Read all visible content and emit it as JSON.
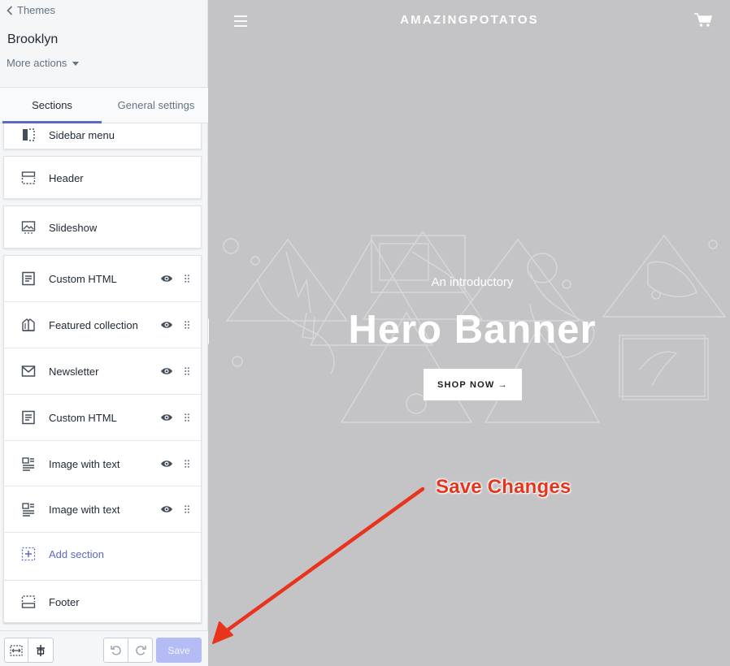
{
  "sidebar": {
    "back_label": "Themes",
    "theme_name": "Brooklyn",
    "more_actions_label": "More actions",
    "tabs": [
      {
        "label": "Sections"
      },
      {
        "label": "General settings"
      }
    ],
    "sections": [
      {
        "label": "Sidebar menu",
        "icon": "sidebar-layout-icon"
      },
      {
        "label": "Header",
        "icon": "header-layout-icon"
      },
      {
        "label": "Slideshow",
        "icon": "slideshow-icon"
      },
      {
        "label": "Custom HTML",
        "icon": "document-text-icon"
      },
      {
        "label": "Featured collection",
        "icon": "collection-book-icon"
      },
      {
        "label": "Newsletter",
        "icon": "mail-icon"
      },
      {
        "label": "Custom HTML",
        "icon": "document-text-icon"
      },
      {
        "label": "Image with text",
        "icon": "image-text-icon"
      },
      {
        "label": "Image with text",
        "icon": "image-text-icon"
      },
      {
        "label": "Add section",
        "icon": "add-section-icon"
      },
      {
        "label": "Footer",
        "icon": "footer-layout-icon"
      }
    ],
    "save_label": "Save"
  },
  "preview": {
    "brand": "AMAZINGPOTATOS",
    "hero_subtitle": "An introductory",
    "hero_title": "Hero Banner",
    "shop_button": "SHOP NOW →"
  },
  "annotation": {
    "text": "Save Changes",
    "color": "#e8341c"
  },
  "colors": {
    "accent": "#5c6ac4",
    "save_disabled": "#b3bcf5",
    "preview_bg": "#c4c4c6"
  }
}
